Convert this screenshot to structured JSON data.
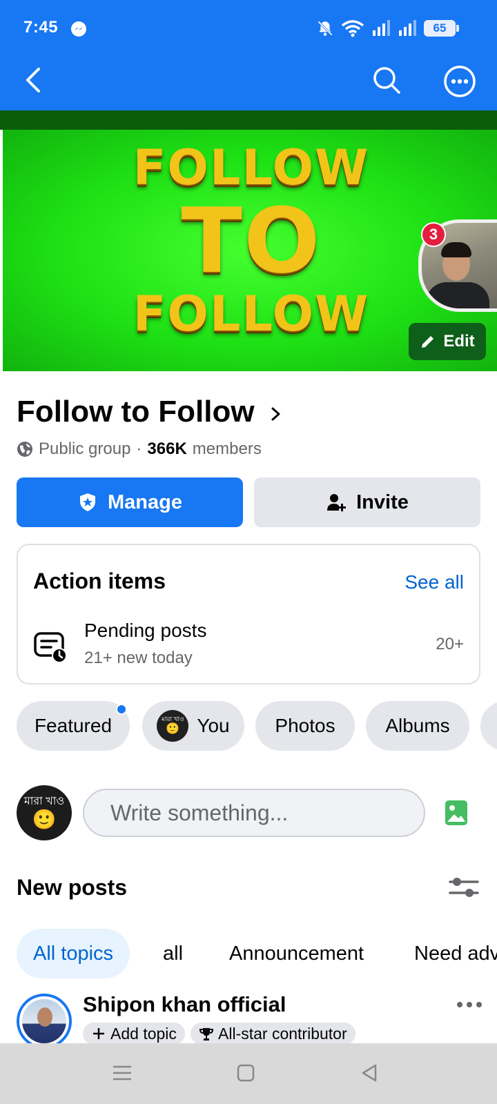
{
  "status_bar": {
    "time": "7:45",
    "battery": "65"
  },
  "group": {
    "name": "Follow to Follow",
    "privacy": "Public group",
    "separator": "·",
    "member_count": "366K",
    "members_label": "members",
    "cover_lines": [
      "FOLLOW",
      "TO",
      "FOLLOW"
    ],
    "notification_count": "3",
    "edit_label": "Edit"
  },
  "actions": {
    "manage_label": "Manage",
    "invite_label": "Invite"
  },
  "action_items": {
    "title": "Action items",
    "see_all": "See all",
    "row_title": "Pending posts",
    "row_subtitle": "21+ new today",
    "row_count": "20+"
  },
  "tabs": [
    {
      "label": "Featured",
      "has_dot": true
    },
    {
      "label": "You"
    },
    {
      "label": "Photos"
    },
    {
      "label": "Albums"
    }
  ],
  "user_avatar_text": {
    "line1": "মারা খাও",
    "emoji": "🙂"
  },
  "composer": {
    "placeholder": "Write something..."
  },
  "feed": {
    "section_title": "New posts",
    "topics": [
      "All topics",
      "all",
      "Announcement",
      "Need adv"
    ],
    "post": {
      "author": "Shipon khan official",
      "add_topic": "Add topic",
      "badge": "All-star contributor"
    }
  },
  "colors": {
    "brand": "#1877f2",
    "cover_green": "#1ee014",
    "badge_red": "#e41e3f"
  }
}
